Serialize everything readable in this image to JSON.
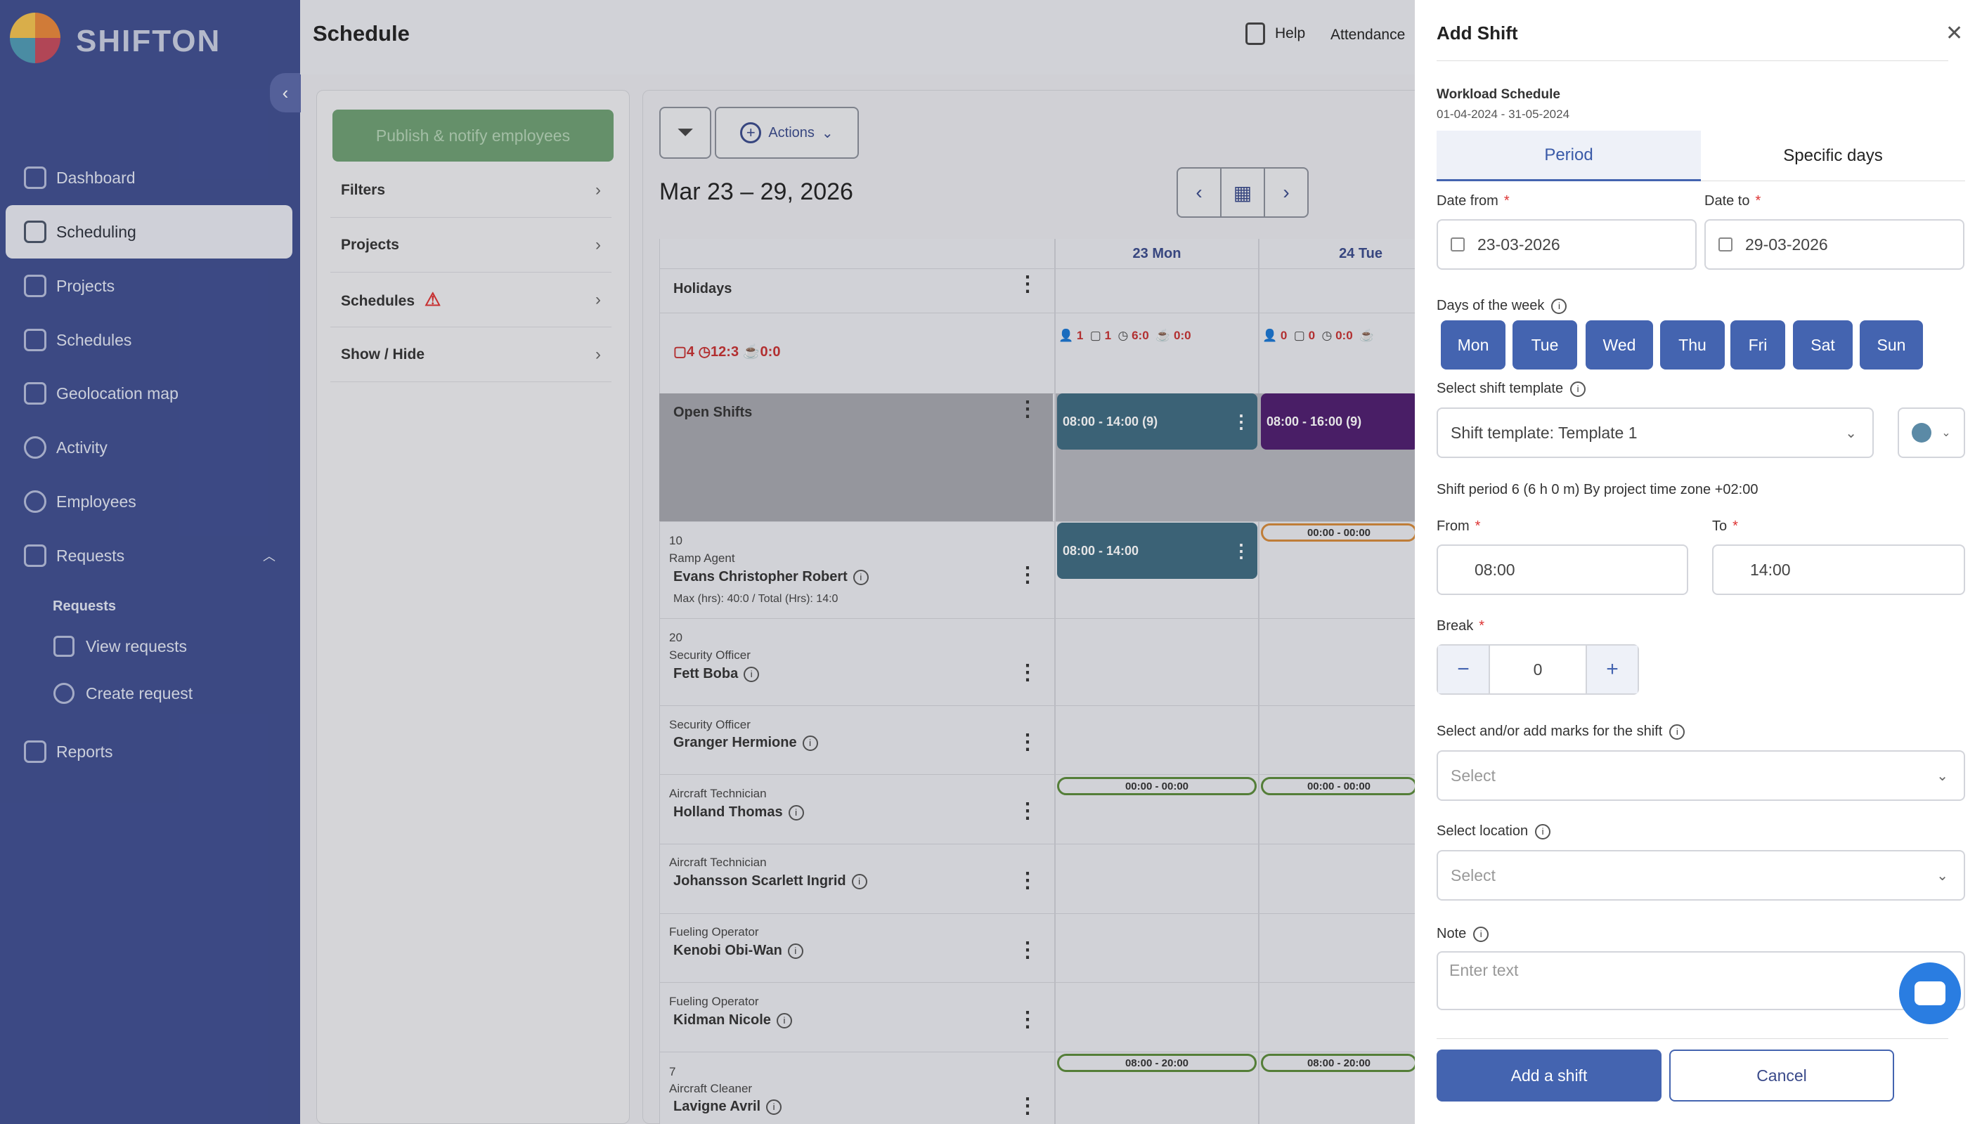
{
  "brand": "SHIFTON",
  "sidebar": {
    "items": [
      {
        "label": "Dashboard",
        "icon": "grid-icon"
      },
      {
        "label": "Scheduling",
        "icon": "calendar-icon",
        "active": true
      },
      {
        "label": "Projects",
        "icon": "briefcase-icon"
      },
      {
        "label": "Schedules",
        "icon": "clipboard-icon"
      },
      {
        "label": "Geolocation map",
        "icon": "map-icon"
      },
      {
        "label": "Activity",
        "icon": "clock-icon"
      },
      {
        "label": "Employees",
        "icon": "users-icon"
      },
      {
        "label": "Requests",
        "icon": "request-icon"
      }
    ],
    "requests_sub": {
      "heading": "Requests",
      "view": "View requests",
      "create": "Create request"
    },
    "reports": "Reports"
  },
  "header": {
    "title": "Schedule",
    "help": "Help",
    "attendance": "Attendance"
  },
  "filters": {
    "publish": "Publish & notify employees",
    "rows": [
      "Filters",
      "Projects",
      "Schedules",
      "Show / Hide"
    ]
  },
  "schedule": {
    "actions": "Actions",
    "date_range": "Mar 23 – 29, 2026",
    "days": [
      "23 Mon",
      "24 Tue"
    ],
    "holidays": "Holidays",
    "summary": {
      "c": "4",
      "t": "12:3",
      "b": "0:0"
    },
    "day_stats": [
      {
        "p": "1",
        "c": "1",
        "t": "6:0",
        "b": "0:0"
      },
      {
        "p": "0",
        "c": "0",
        "t": "0:0",
        "b": ""
      }
    ],
    "open_shifts": "Open Shifts",
    "open_shift_mon": "08:00 - 14:00 (9)",
    "open_shift_tue": "08:00 - 16:00 (9)",
    "employees": [
      {
        "num": "10",
        "role": "Ramp Agent",
        "name": "Evans Christopher Robert",
        "hours": "Max (hrs): 40:0 / Total (Hrs): 14:0"
      },
      {
        "num": "20",
        "role": "Security Officer",
        "name": "Fett Boba"
      },
      {
        "role": "Security Officer",
        "name": "Granger Hermione"
      },
      {
        "role": "Aircraft Technician",
        "name": "Holland Thomas"
      },
      {
        "role": "Aircraft Technician",
        "name": "Johansson Scarlett Ingrid"
      },
      {
        "role": "Fueling Operator",
        "name": "Kenobi Obi-Wan"
      },
      {
        "role": "Fueling Operator",
        "name": "Kidman Nicole"
      },
      {
        "num": "7",
        "role": "Aircraft Cleaner",
        "name": "Lavigne Avril"
      }
    ],
    "evans_shift": "08:00 - 14:00",
    "pill_zero": "00:00 - 00:00",
    "pill_long": "08:00 - 20:00"
  },
  "modal": {
    "title": "Add Shift",
    "schedule_name": "Workload Schedule",
    "schedule_range": "01-04-2024 - 31-05-2024",
    "tabs": [
      "Period",
      "Specific days"
    ],
    "date_from_label": "Date from",
    "date_to_label": "Date to",
    "date_from": "23-03-2026",
    "date_to": "29-03-2026",
    "days_label": "Days of the week",
    "days": [
      "Mon",
      "Tue",
      "Wed",
      "Thu",
      "Fri",
      "Sat",
      "Sun"
    ],
    "template_label": "Select shift template",
    "template_value": "Shift template: Template 1",
    "template_color": "#5b8aa6",
    "shift_period": "Shift period 6 (6 h 0 m) By project time zone +02:00",
    "from_label": "From",
    "to_label": "To",
    "from_value": "08:00",
    "to_value": "14:00",
    "break_label": "Break",
    "break_value": "0",
    "marks_label": "Select and/or add marks for the shift",
    "select_placeholder": "Select",
    "location_label": "Select location",
    "note_label": "Note",
    "note_placeholder": "Enter text",
    "add_button": "Add a shift",
    "cancel_button": "Cancel"
  },
  "colors": {
    "sidebar": "#3f4e8f",
    "primary": "#4464b0",
    "shift_teal": "#3e6a80",
    "shift_purple": "#4e1d6e",
    "publish": "#6e9f72"
  }
}
